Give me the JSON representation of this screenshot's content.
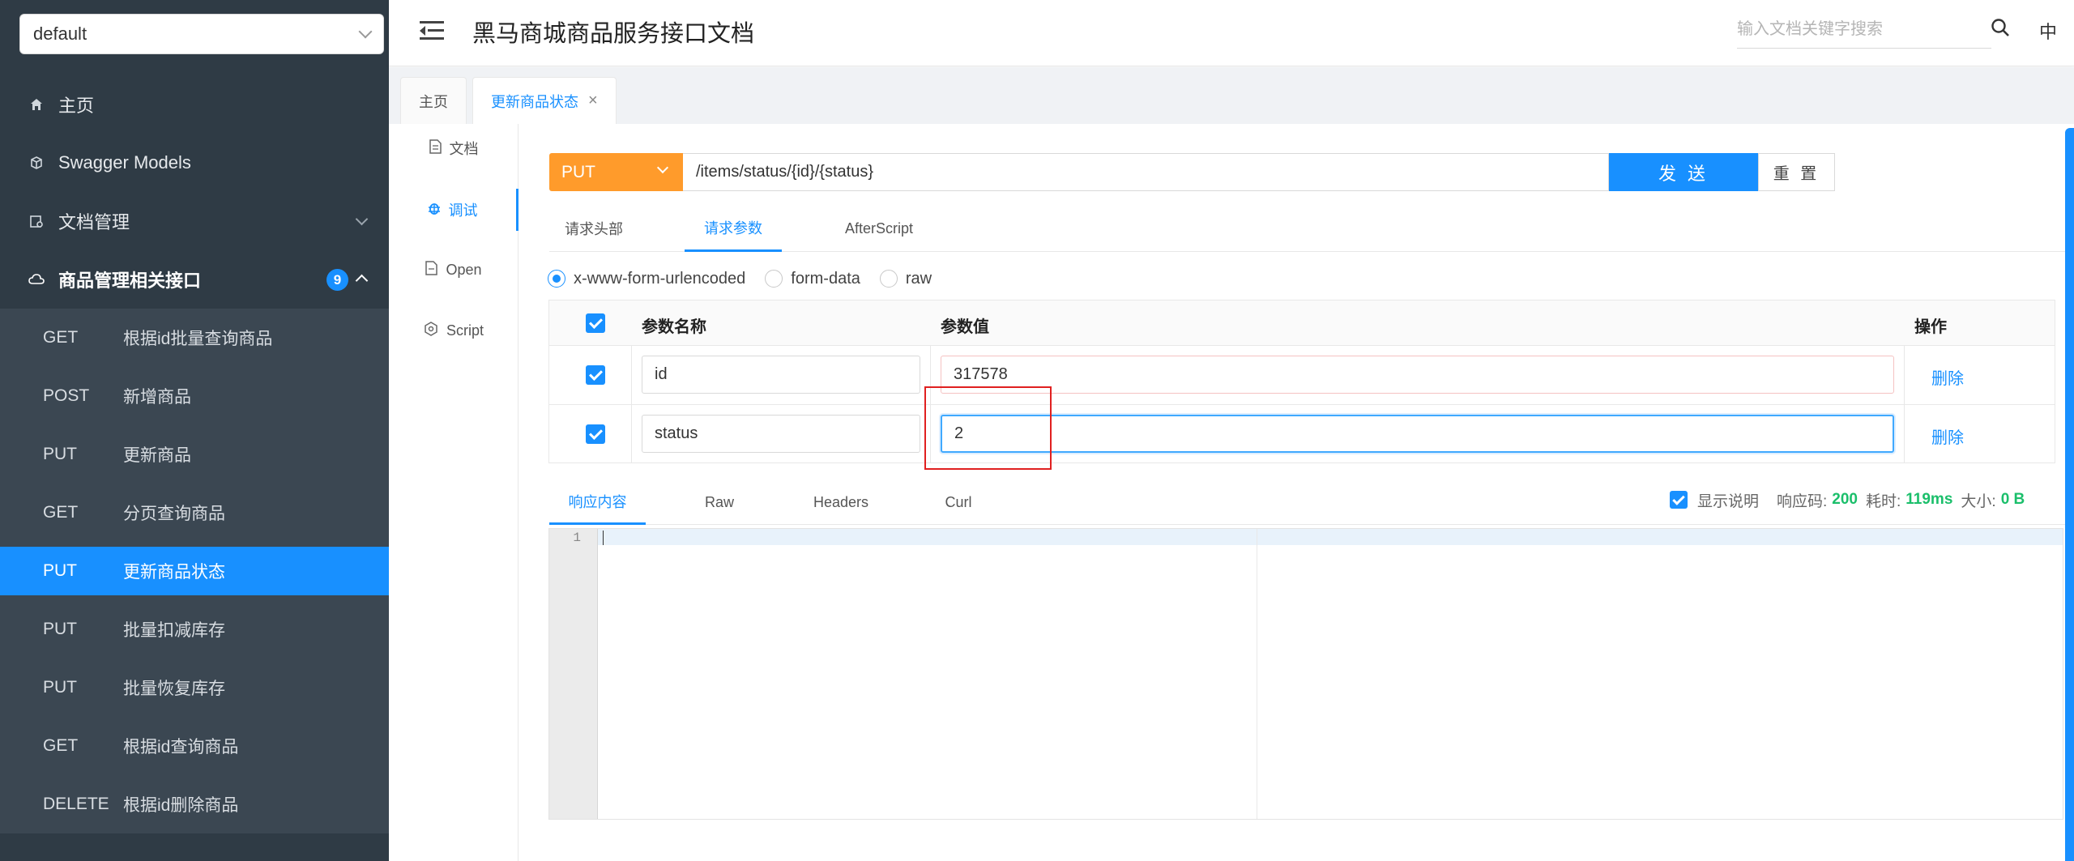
{
  "sidebar": {
    "group_select": "default",
    "menu": [
      {
        "label": "主页"
      },
      {
        "label": "Swagger Models"
      },
      {
        "label": "文档管理"
      },
      {
        "label": "商品管理相关接口",
        "badge": "9"
      }
    ],
    "apis": [
      {
        "method": "GET",
        "name": "根据id批量查询商品"
      },
      {
        "method": "POST",
        "name": "新增商品"
      },
      {
        "method": "PUT",
        "name": "更新商品"
      },
      {
        "method": "GET",
        "name": "分页查询商品"
      },
      {
        "method": "PUT",
        "name": "更新商品状态",
        "active": true
      },
      {
        "method": "PUT",
        "name": "批量扣减库存"
      },
      {
        "method": "PUT",
        "name": "批量恢复库存"
      },
      {
        "method": "GET",
        "name": "根据id查询商品"
      },
      {
        "method": "DELETE",
        "name": "根据id删除商品"
      }
    ]
  },
  "header": {
    "title": "黑马商城商品服务接口文档",
    "search_placeholder": "输入文档关键字搜索",
    "lang": "中"
  },
  "tabs": [
    {
      "label": "主页"
    },
    {
      "label": "更新商品状态",
      "active": true
    }
  ],
  "vnav": [
    {
      "icon": "document-icon",
      "label": "文档"
    },
    {
      "icon": "bug-icon",
      "label": "调试",
      "active": true
    },
    {
      "icon": "file-icon",
      "label": "Open"
    },
    {
      "icon": "code-icon",
      "label": "Script"
    }
  ],
  "request": {
    "method": "PUT",
    "url": "/items/status/{id}/{status}",
    "send_label": "发 送",
    "reset_label": "重 置"
  },
  "request_tabs": [
    {
      "label": "请求头部"
    },
    {
      "label": "请求参数",
      "active": true
    },
    {
      "label": "AfterScript"
    }
  ],
  "content_types": [
    {
      "label": "x-www-form-urlencoded",
      "selected": true
    },
    {
      "label": "form-data"
    },
    {
      "label": "raw"
    }
  ],
  "params_table": {
    "headers": {
      "name": "参数名称",
      "value": "参数值",
      "action": "操作"
    },
    "rows": [
      {
        "name": "id",
        "value": "317578",
        "action": "删除"
      },
      {
        "name": "status",
        "value": "2",
        "action": "删除"
      }
    ]
  },
  "response": {
    "tabs": [
      {
        "label": "响应内容",
        "active": true
      },
      {
        "label": "Raw"
      },
      {
        "label": "Headers"
      },
      {
        "label": "Curl"
      }
    ],
    "show_desc_label": "显示说明",
    "code_label": "响应码:",
    "code": "200",
    "time_label": "耗时:",
    "time": "119ms",
    "size_label": "大小:",
    "size": "0 B",
    "line_number": "1"
  },
  "colors": {
    "accent": "#1890ff",
    "method_put": "#ff9b2b",
    "sidebar_bg": "#2f3b45",
    "success": "#1bbf6b",
    "highlight": "#e02020"
  }
}
